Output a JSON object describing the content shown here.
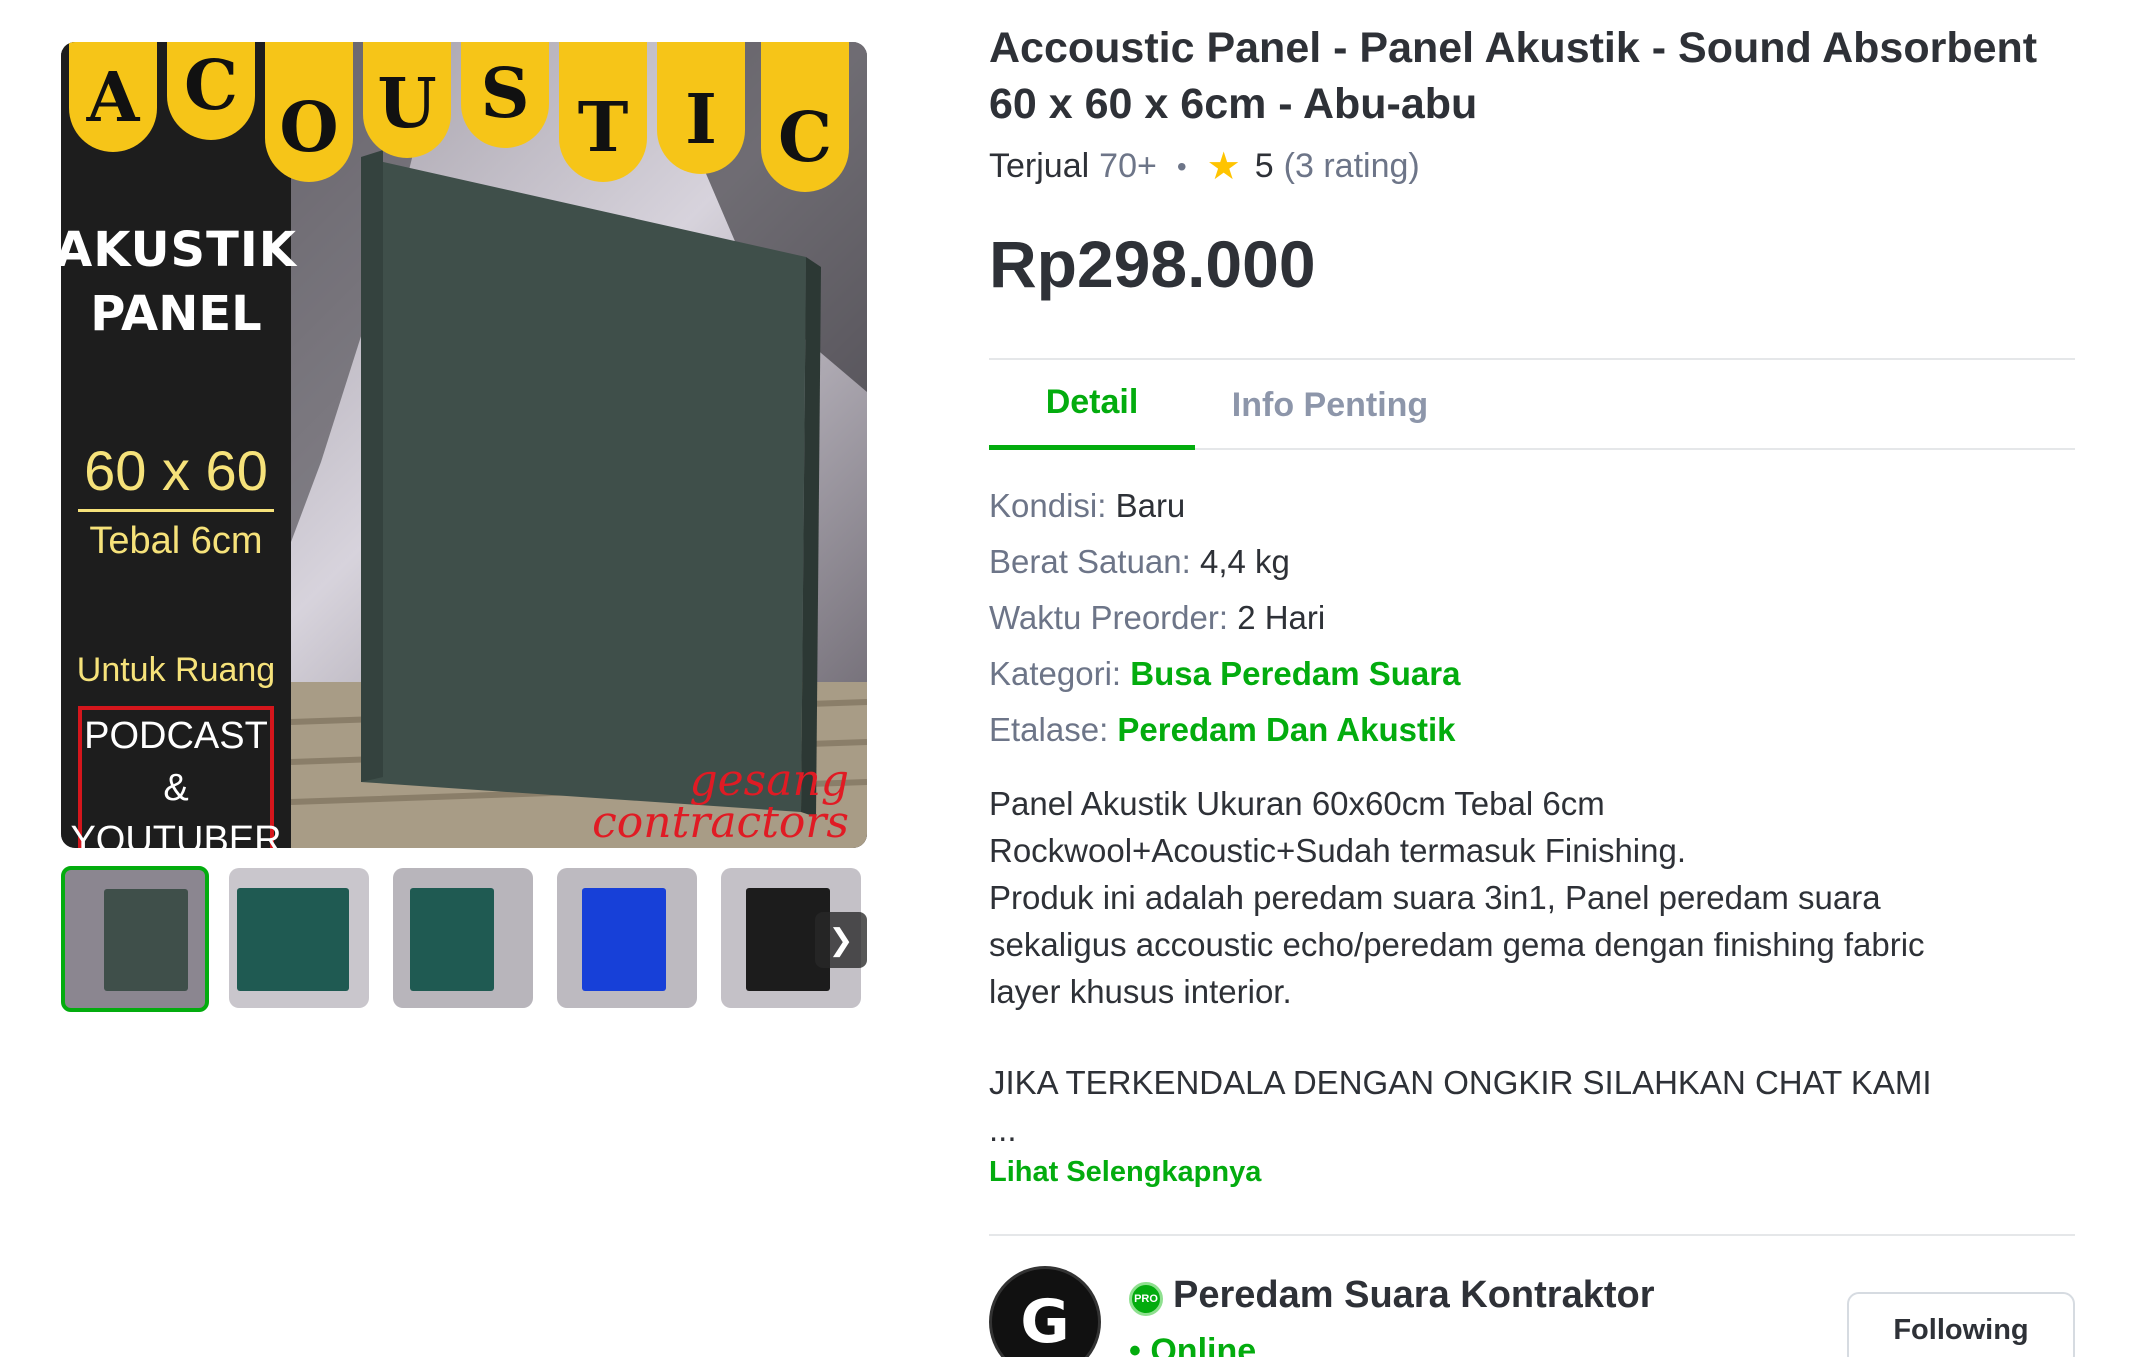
{
  "gallery": {
    "banner_letters": [
      "A",
      "C",
      "O",
      "U",
      "S",
      "T",
      "I",
      "C"
    ],
    "akustik": "AKUSTIK",
    "panel": "PANEL",
    "size": "60 x 60",
    "thickness": "Tebal 6cm",
    "untuk": "Untuk Ruang",
    "box_line1": "PODCAST",
    "box_line2": "&",
    "box_line3": "YOUTUBER",
    "brand_line1": "gesang",
    "brand_line2": "contractors",
    "thumbnail_colors": [
      "#3f4f4a",
      "#1f5a52",
      "#1f5a52",
      "#1740d8",
      "#1c1c1c"
    ],
    "next_icon": "chevron-right-icon"
  },
  "product": {
    "title": "Accoustic Panel - Panel Akustik - Sound Absorbent 60 x 60 x 6cm - Abu-abu",
    "sold_label": "Terjual",
    "sold_count": "70+",
    "rating": "5",
    "rating_count": "(3 rating)",
    "price": "Rp298.000"
  },
  "tabs": {
    "detail": "Detail",
    "info": "Info Penting"
  },
  "specs": {
    "kondisi_label": "Kondisi:",
    "kondisi_value": "Baru",
    "berat_label": "Berat Satuan:",
    "berat_value": "4,4 kg",
    "preorder_label": "Waktu Preorder:",
    "preorder_value": "2 Hari",
    "kategori_label": "Kategori:",
    "kategori_value": "Busa Peredam Suara",
    "etalase_label": "Etalase:",
    "etalase_value": "Peredam Dan Akustik"
  },
  "description": {
    "line1": "Panel Akustik Ukuran 60x60cm Tebal 6cm",
    "line2": "Rockwool+Acoustic+Sudah termasuk Finishing.",
    "line3": "Produk ini adalah peredam suara 3in1, Panel peredam suara",
    "line4": "sekaligus accoustic echo/peredam gema dengan finishing fabric",
    "line5": "layer khusus interior.",
    "line6": "JIKA TERKENDALA DENGAN ONGKIR SILAHKAN CHAT KAMI",
    "ellipsis": "...",
    "more_link": "Lihat Selengkapnya"
  },
  "seller": {
    "pro_badge": "PRO",
    "name": "Peredam Suara Kontraktor",
    "status": "• Online",
    "follow_button": "Following"
  },
  "colors": {
    "accent_green": "#03ac0e",
    "banner_yellow": "#f6c518",
    "star": "#ffc400"
  }
}
